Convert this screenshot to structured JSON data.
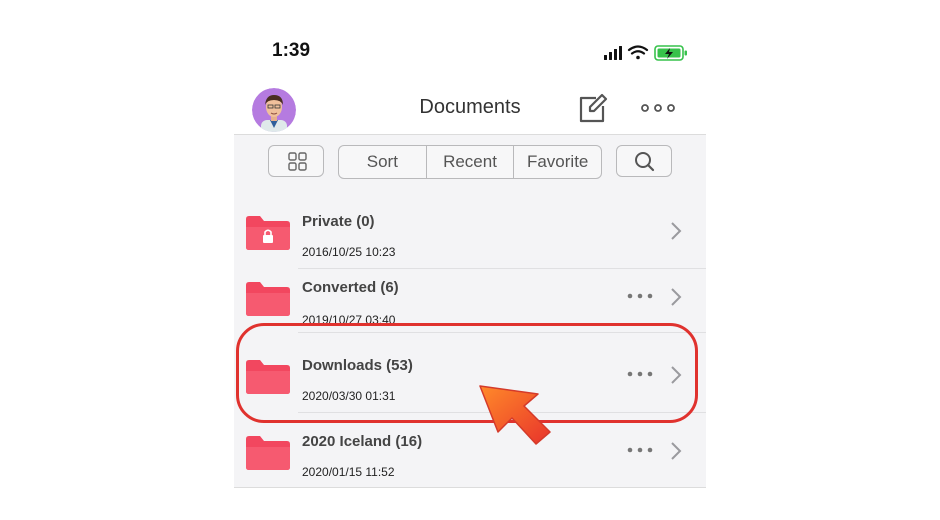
{
  "status": {
    "time": "1:39"
  },
  "nav": {
    "title": "Documents"
  },
  "toolbar": {
    "segments": [
      "Sort",
      "Recent",
      "Favorite"
    ]
  },
  "folders": [
    {
      "name": "Private (0)",
      "date": "2016/10/25 10:23",
      "locked": true,
      "has_more": false
    },
    {
      "name": "Converted (6)",
      "date": "2019/10/27 03:40",
      "locked": false,
      "has_more": true
    },
    {
      "name": "Downloads (53)",
      "date": "2020/03/30 01:31",
      "locked": false,
      "has_more": true
    },
    {
      "name": "2020 Iceland (16)",
      "date": "2020/01/15 11:52",
      "locked": false,
      "has_more": true
    }
  ],
  "colors": {
    "folder": "#f2475f",
    "annotation": "#e0322e",
    "battery": "#37c24b"
  }
}
